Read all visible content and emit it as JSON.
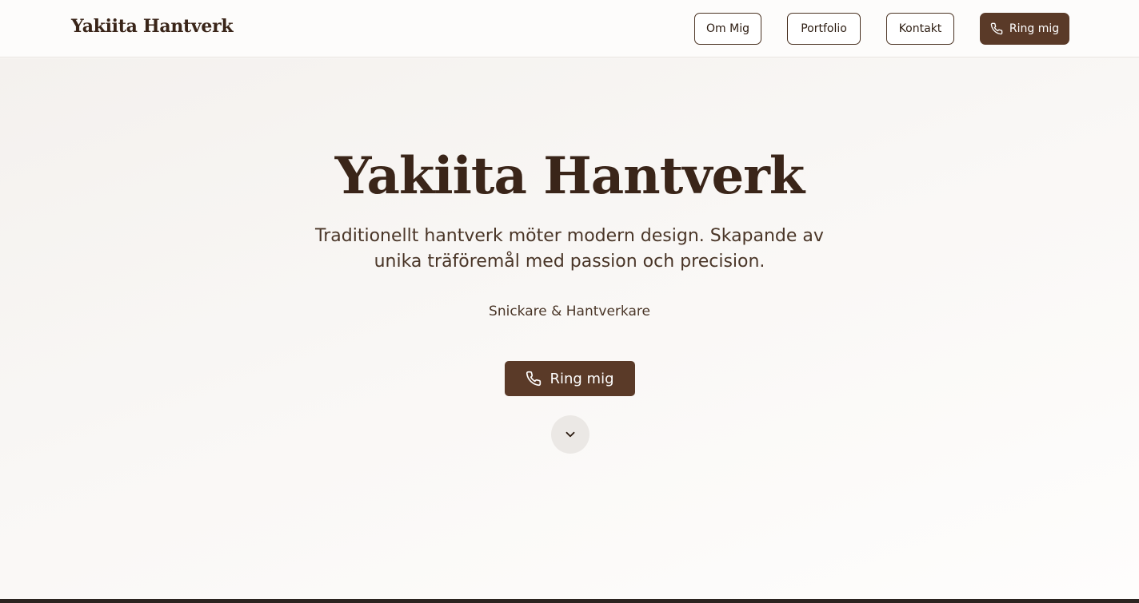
{
  "header": {
    "brand": "Yakiita Hantverk",
    "nav": {
      "about_label": "Om Mig",
      "portfolio_label": "Portfolio",
      "contact_label": "Kontakt",
      "call_label": "Ring mig",
      "call_icon": "phone-icon"
    }
  },
  "hero": {
    "title": "Yakiita Hantverk",
    "subtitle": "Traditionellt hantverk möter modern design. Skapande av unika träföremål med passion och precision.",
    "role": "Snickare & Hantverkare",
    "cta_label": "Ring mig",
    "cta_icon": "phone-icon",
    "scroll_icon": "chevron-down-icon"
  },
  "colors": {
    "brand_brown": "#5a3a28",
    "heading_text": "#3a2519",
    "body_text": "#4a3628",
    "background": "#faf8f6",
    "scroll_button_bg": "#ebe8e5"
  }
}
